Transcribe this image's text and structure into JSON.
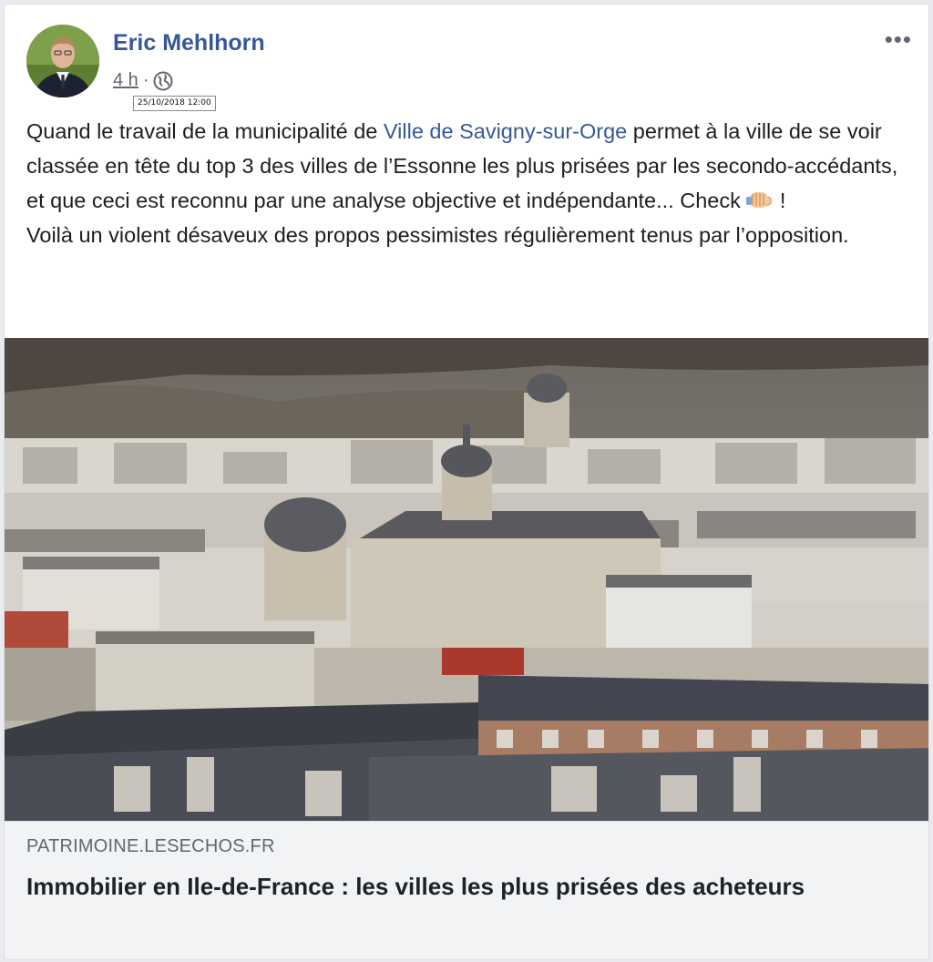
{
  "post": {
    "author": "Eric Mehlhorn",
    "time": "4 h",
    "separator": "·",
    "tooltip": "25/10/2018 12:00",
    "more_label": "•••",
    "text": {
      "intro": "Quand le travail de la municipalité de ",
      "page_link": "Ville de Savigny-sur-Orge",
      "body": " permet à la ville de se voir classée en tête du top 3 des villes de l’Essonne les plus prisées par les secondo-accédants, et que ceci est reconnu par une analyse objective et indépendante... Check ",
      "emoji": "fist-bump-icon",
      "exclaim": " !",
      "line2": "Voilà un violent désaveux des propos pessimistes régulièrement tenus par l’opposition."
    }
  },
  "link_preview": {
    "domain": "PATRIMOINE.LESECHOS.FR",
    "title": "Immobilier en Ile-de-France : les villes les plus prisées des acheteurs"
  },
  "icons": {
    "audience": "globe-icon",
    "menu": "more-icon"
  },
  "colors": {
    "link": "#385898",
    "text": "#1c1e21",
    "secondary": "#606770",
    "preview_bg": "#f2f3f5"
  }
}
